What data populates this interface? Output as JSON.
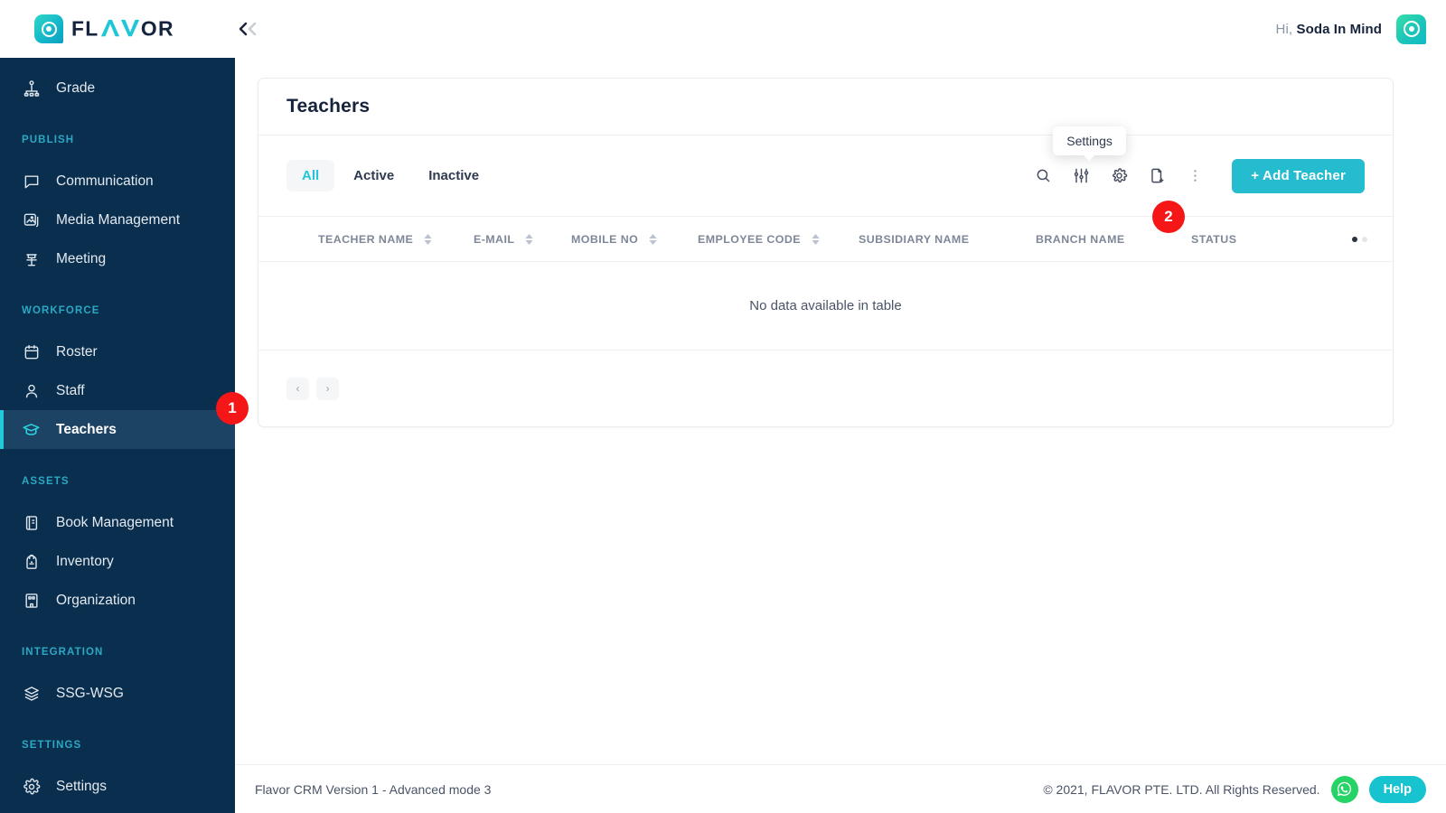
{
  "topbar": {
    "brand_name": "FLAVOR",
    "collapse_icon": "double-chevron-left-icon",
    "greeting_prefix": "Hi,",
    "user_name": "Soda In Mind"
  },
  "sidebar": {
    "items": [
      {
        "label": "Grade",
        "icon": "grade-hierarchy-icon",
        "type": "item"
      },
      {
        "label": "PUBLISH",
        "type": "section"
      },
      {
        "label": "Communication",
        "icon": "chat-bubble-icon",
        "type": "item"
      },
      {
        "label": "Media Management",
        "icon": "image-stack-icon",
        "type": "item"
      },
      {
        "label": "Meeting",
        "icon": "podium-icon",
        "type": "item"
      },
      {
        "label": "WORKFORCE",
        "type": "section"
      },
      {
        "label": "Roster",
        "icon": "calendar-icon",
        "type": "item"
      },
      {
        "label": "Staff",
        "icon": "user-icon",
        "type": "item"
      },
      {
        "label": "Teachers",
        "icon": "graduation-cap-icon",
        "type": "item",
        "active": true
      },
      {
        "label": "ASSETS",
        "type": "section"
      },
      {
        "label": "Book Management",
        "icon": "book-icon",
        "type": "item"
      },
      {
        "label": "Inventory",
        "icon": "backpack-icon",
        "type": "item"
      },
      {
        "label": "Organization",
        "icon": "building-icon",
        "type": "item"
      },
      {
        "label": "INTEGRATION",
        "type": "section"
      },
      {
        "label": "SSG-WSG",
        "icon": "layers-icon",
        "type": "item"
      },
      {
        "label": "SETTINGS",
        "type": "section"
      },
      {
        "label": "Settings",
        "icon": "gear-icon",
        "type": "item"
      }
    ]
  },
  "badges": [
    {
      "id": "1",
      "text": "1"
    },
    {
      "id": "2",
      "text": "2"
    }
  ],
  "card": {
    "title": "Teachers",
    "tabs": [
      {
        "label": "All",
        "selected": true
      },
      {
        "label": "Active",
        "selected": false
      },
      {
        "label": "Inactive",
        "selected": false
      }
    ],
    "tools": [
      {
        "name": "search-icon",
        "label": "Search"
      },
      {
        "name": "filter-sliders-icon",
        "label": "Filter"
      },
      {
        "name": "gear-icon",
        "label": "Settings"
      },
      {
        "name": "document-add-icon",
        "label": "Export"
      },
      {
        "name": "more-vertical-icon",
        "label": "More"
      }
    ],
    "tooltip_text": "Settings",
    "add_button_label": "+ Add Teacher",
    "table": {
      "columns": [
        {
          "label": "TEACHER NAME",
          "sortable": true
        },
        {
          "label": "E-MAIL",
          "sortable": true
        },
        {
          "label": "MOBILE NO",
          "sortable": true
        },
        {
          "label": "EMPLOYEE CODE",
          "sortable": true
        },
        {
          "label": "SUBSIDIARY NAME",
          "sortable": false
        },
        {
          "label": "BRANCH NAME",
          "sortable": false
        },
        {
          "label": "STATUS",
          "sortable": false
        }
      ],
      "rows": [],
      "empty_message": "No data available in table"
    },
    "pagination": {
      "prev_label": "‹",
      "next_label": "›"
    }
  },
  "footer": {
    "version_text": "Flavor CRM Version 1 - Advanced mode 3",
    "copyright": "© 2021, FLAVOR PTE. LTD. All Rights Reserved.",
    "whatsapp_icon": "whatsapp-icon",
    "help_label": "Help"
  },
  "colors": {
    "sidebar_bg": "#0a2e4e",
    "sidebar_active_bg": "#1c4264",
    "accent_teal": "#26bcd0",
    "section_label": "#2ba8c4",
    "badge_red": "#f51717",
    "title_navy": "#16233c",
    "whatsapp_green": "#25d366"
  }
}
